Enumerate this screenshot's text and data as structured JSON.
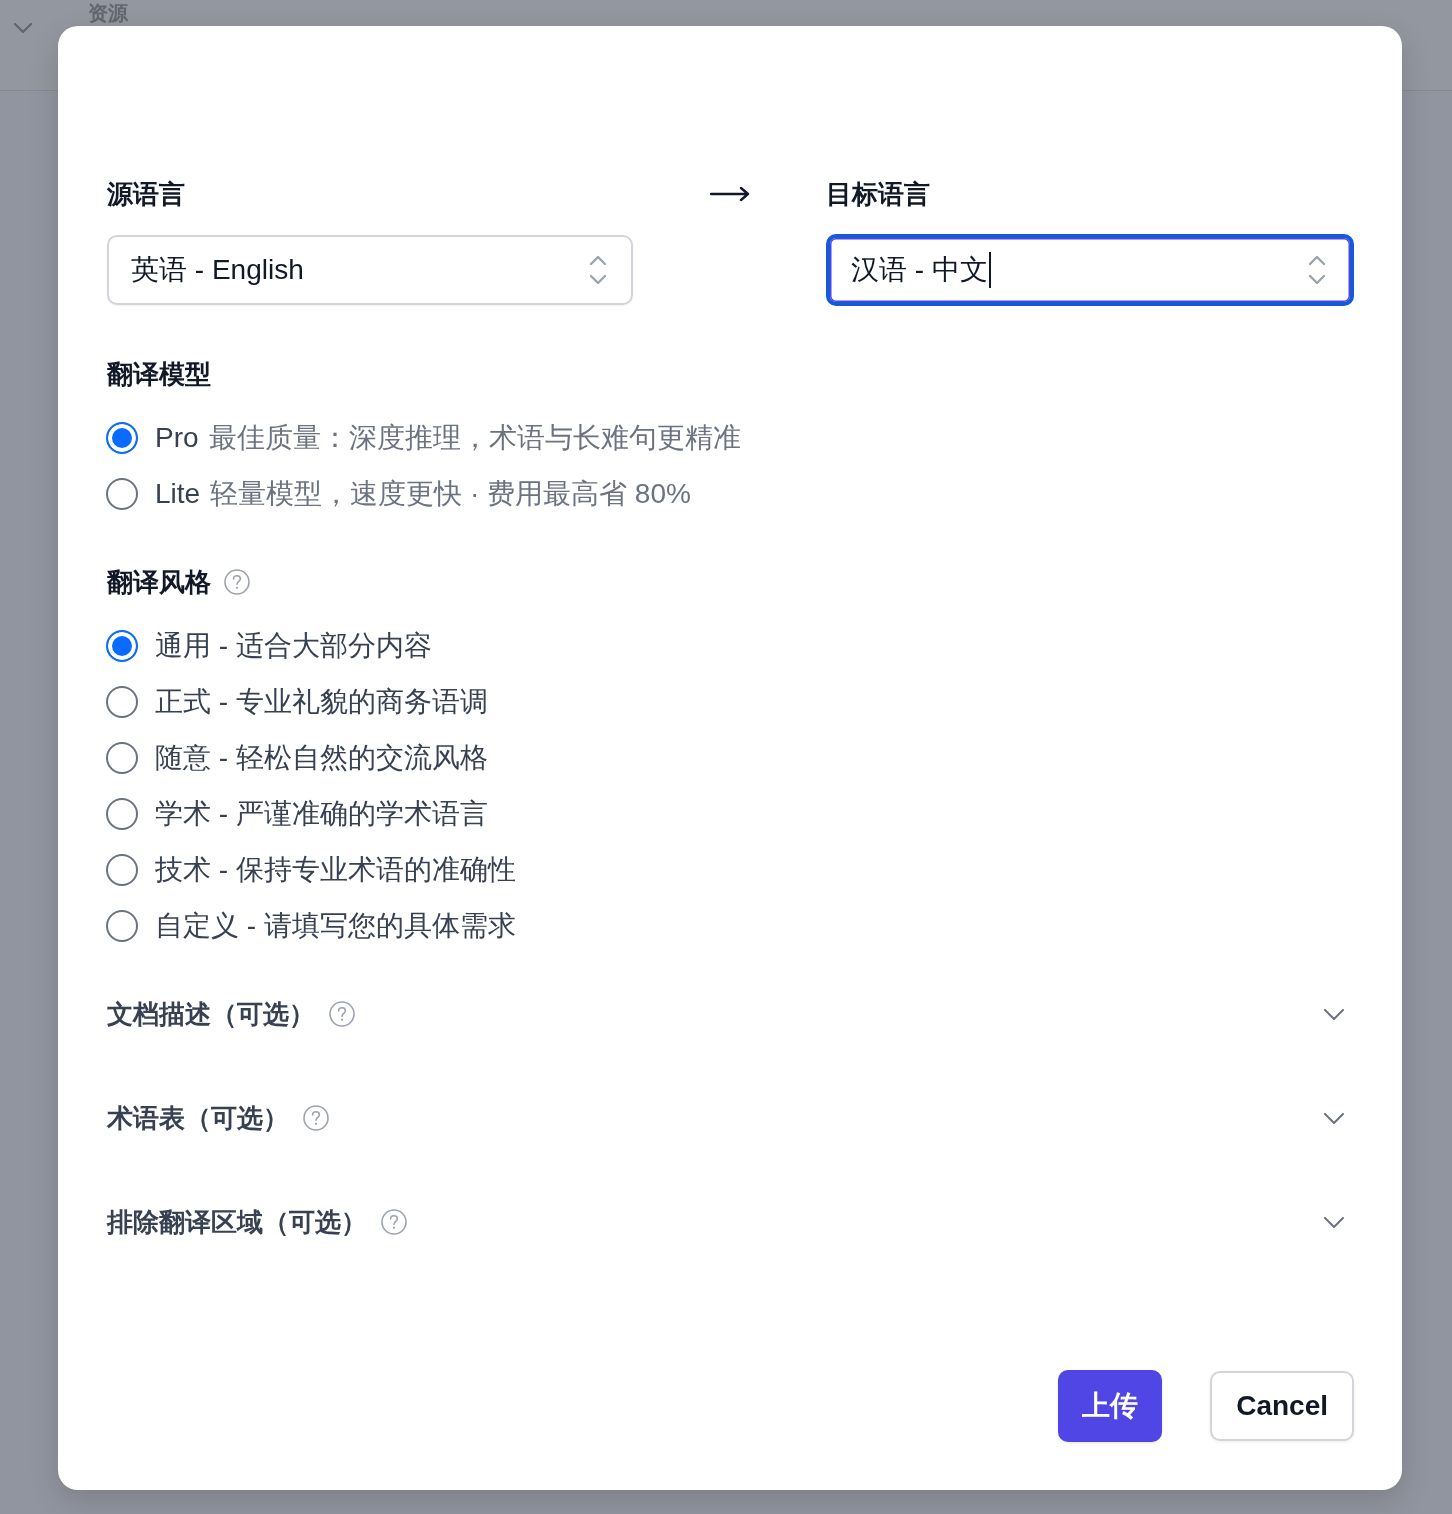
{
  "background": {
    "title": "资源"
  },
  "dialog": {
    "source_language": {
      "label": "源语言",
      "value": "英语 - English",
      "focused": false
    },
    "target_language": {
      "label": "目标语言",
      "value": "汉语 - 中文",
      "focused": true
    },
    "model": {
      "label": "翻译模型",
      "options": [
        {
          "name": "Pro",
          "description": "最佳质量：深度推理，术语与长难句更精准",
          "selected": true
        },
        {
          "name": "Lite",
          "description": "轻量模型，速度更快 · 费用最高省 80%",
          "selected": false
        }
      ]
    },
    "style": {
      "label": "翻译风格",
      "options": [
        {
          "label": "通用 - 适合大部分内容",
          "selected": true
        },
        {
          "label": "正式 - 专业礼貌的商务语调",
          "selected": false
        },
        {
          "label": "随意 - 轻松自然的交流风格",
          "selected": false
        },
        {
          "label": "学术 - 严谨准确的学术语言",
          "selected": false
        },
        {
          "label": "技术 - 保持专业术语的准确性",
          "selected": false
        },
        {
          "label": "自定义 - 请填写您的具体需求",
          "selected": false
        }
      ]
    },
    "sections": [
      {
        "label": "文档描述（可选）",
        "expanded": false
      },
      {
        "label": "术语表（可选）",
        "expanded": false
      },
      {
        "label": "排除翻译区域（可选）",
        "expanded": false
      }
    ],
    "buttons": [
      {
        "label": "上传",
        "kind": "primary"
      },
      {
        "label": "Cancel",
        "kind": "secondary"
      }
    ]
  }
}
